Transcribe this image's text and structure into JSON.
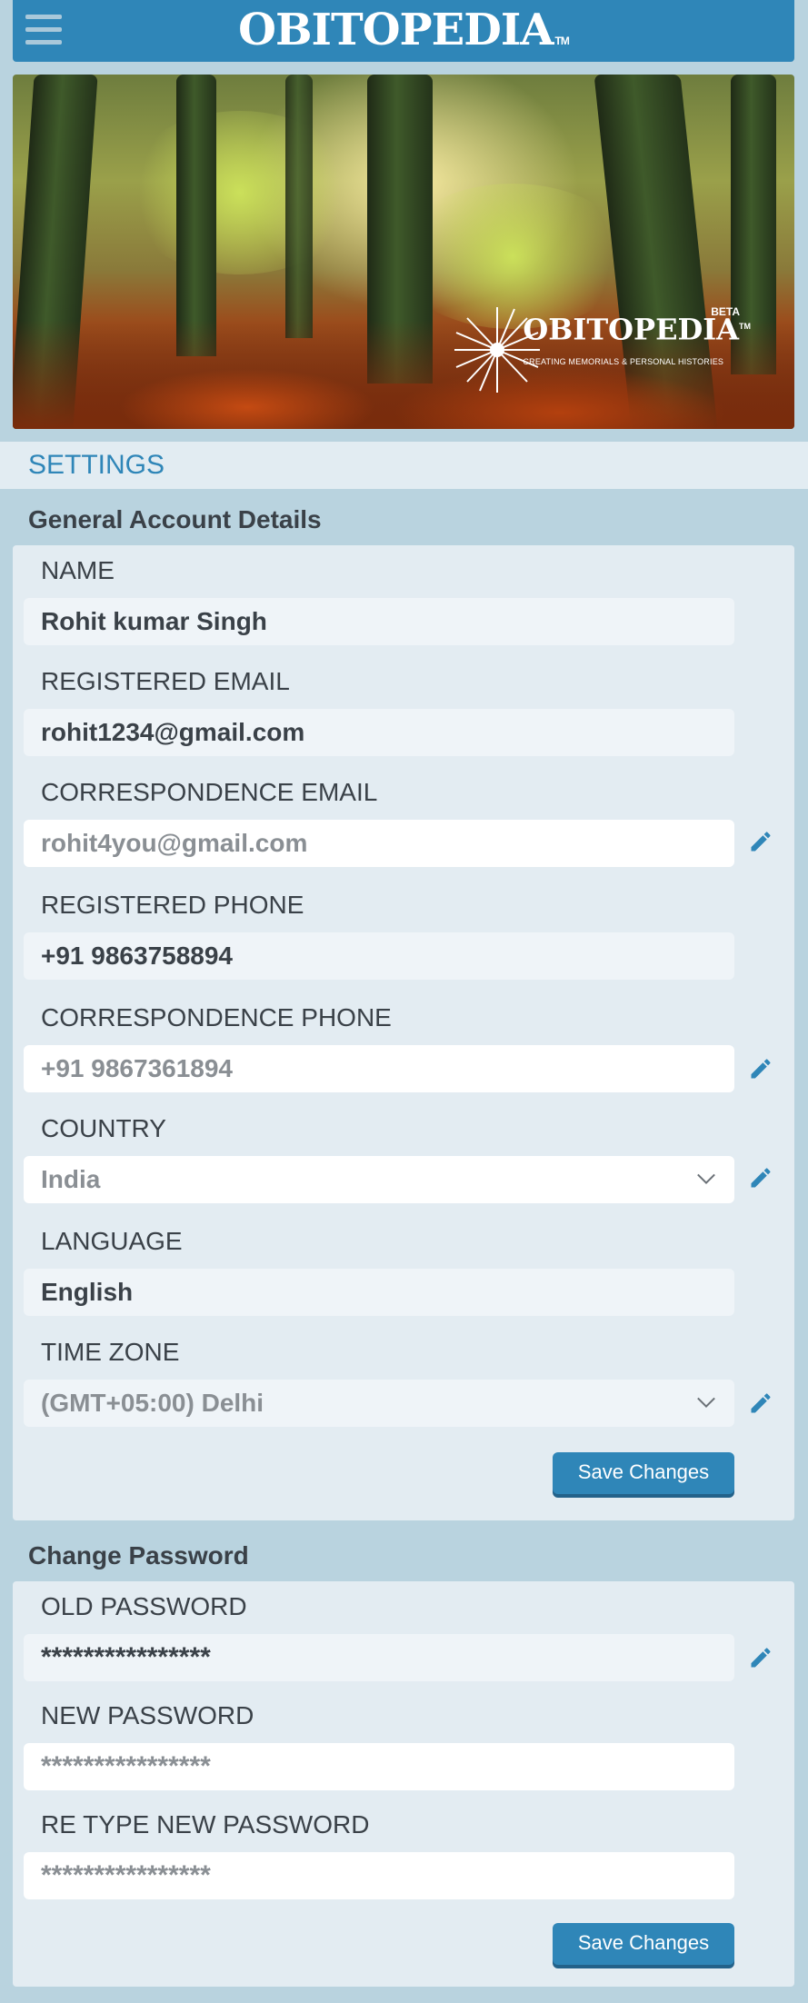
{
  "header": {
    "logo": "OBITOPEDIA",
    "trademark": "TM"
  },
  "banner": {
    "beta": "BETA",
    "logo": "OBITOPEDIA",
    "trademark": "TM",
    "tagline": "CREATING MEMORIALS & PERSONAL HISTORIES"
  },
  "page": {
    "title": "SETTINGS"
  },
  "general": {
    "title": "General Account Details",
    "name_label": "NAME",
    "name_value": "Rohit kumar Singh",
    "reg_email_label": "REGISTERED EMAIL",
    "reg_email_value": "rohit1234@gmail.com",
    "corr_email_label": "CORRESPONDENCE EMAIL",
    "corr_email_value": "rohit4you@gmail.com",
    "reg_phone_label": "REGISTERED PHONE",
    "reg_phone_value": "+91 9863758894",
    "corr_phone_label": "CORRESPONDENCE PHONE",
    "corr_phone_value": "+91 9867361894",
    "country_label": "COUNTRY",
    "country_value": "India",
    "language_label": "LANGUAGE",
    "language_value": "English",
    "timezone_label": "TIME ZONE",
    "timezone_value": "(GMT+05:00) Delhi",
    "save_label": "Save Changes"
  },
  "password": {
    "title": "Change Password",
    "old_label": "OLD PASSWORD",
    "old_value": "****************",
    "new_label": "NEW PASSWORD",
    "new_value": "****************",
    "retype_label": "RE TYPE NEW PASSWORD",
    "retype_value": "****************",
    "save_label": "Save Changes"
  },
  "colors": {
    "primary": "#2f86b8",
    "background": "#b9d3df",
    "card": "#e3ecf2"
  },
  "icons": [
    "hamburger-icon",
    "pencil-icon",
    "chevron-down-icon",
    "dandelion-icon"
  ]
}
